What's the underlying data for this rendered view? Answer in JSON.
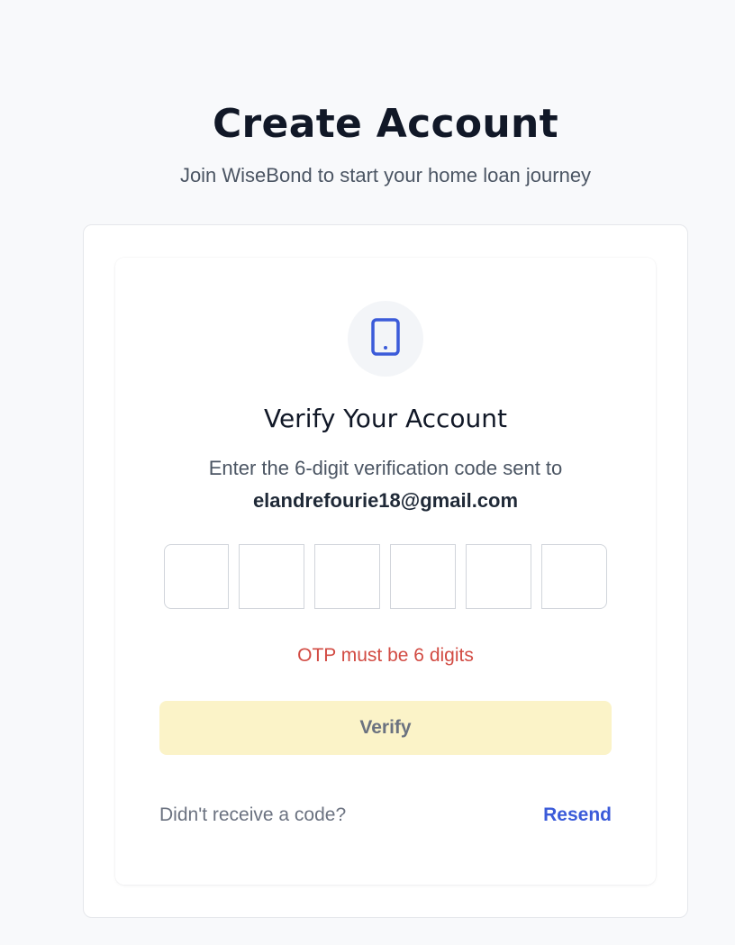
{
  "header": {
    "title": "Create Account",
    "subtitle": "Join WiseBond to start your home loan journey"
  },
  "verification": {
    "icon": "smartphone-icon",
    "heading": "Verify Your Account",
    "description": "Enter the 6-digit verification code sent to",
    "email": "elandrefourie18@gmail.com",
    "otp_digits": [
      "",
      "",
      "",
      "",
      "",
      ""
    ],
    "error": "OTP must be 6 digits",
    "verify_label": "Verify",
    "resend_prompt": "Didn't receive a code?",
    "resend_label": "Resend"
  },
  "colors": {
    "accent": "#3b5bd9",
    "error": "#d24b43",
    "button_disabled_bg": "#fbf3c8"
  }
}
